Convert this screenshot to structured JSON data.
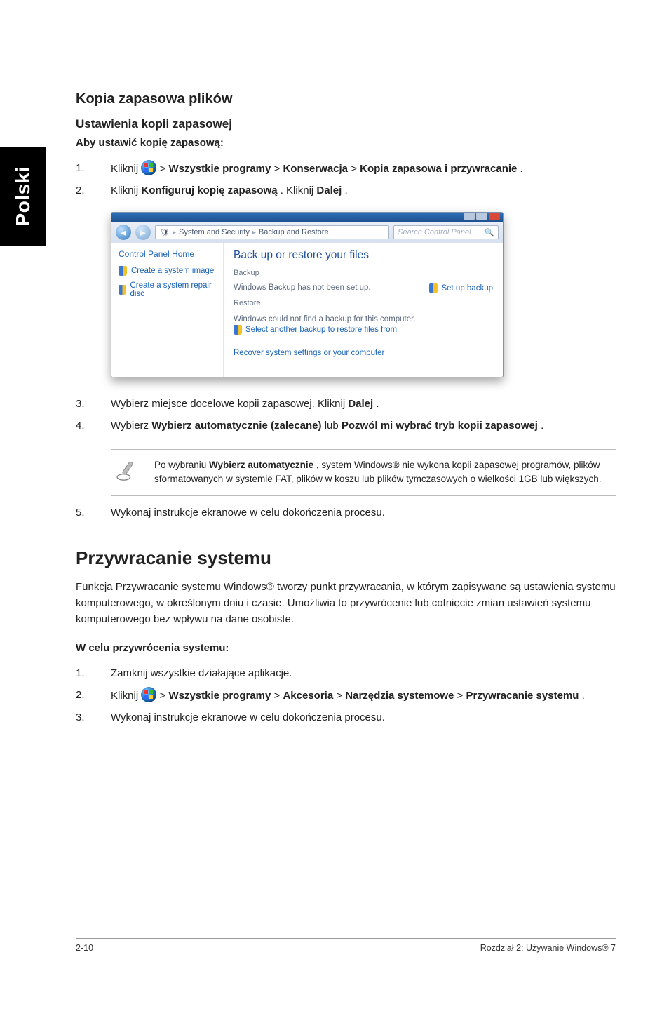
{
  "sidetab": "Polski",
  "h_backup_files": "Kopia zapasowa plików",
  "h_backup_settings": "Ustawienia kopii zapasowej",
  "lead_to_set_backup": "Aby ustawić kopię zapasową:",
  "steps_a": {
    "n1": "1.",
    "t1_pre": "Kliknij ",
    "t1_gt1": " > ",
    "t1_b1": "Wszystkie programy",
    "t1_gt2": " > ",
    "t1_b2": "Konserwacja",
    "t1_gt3": " > ",
    "t1_b3": "Kopia zapasowa i przywracanie",
    "t1_post": ".",
    "n2": "2.",
    "t2_pre": "Kliknij ",
    "t2_b1": "Konfiguruj kopię zapasową",
    "t2_mid": ". Kliknij ",
    "t2_b2": "Dalej",
    "t2_post": "."
  },
  "win": {
    "crumb1": "System and Security",
    "crumb2": "Backup and Restore",
    "search_placeholder": "Search Control Panel",
    "side_home": "Control Panel Home",
    "side_link1": "Create a system image",
    "side_link2": "Create a system repair disc",
    "main_title": "Back up or restore your files",
    "grp_backup": "Backup",
    "backup_msg": "Windows Backup has not been set up.",
    "setup_link": "Set up backup",
    "grp_restore": "Restore",
    "restore_msg1": "Windows could not find a backup for this computer.",
    "restore_msg2": "Select another backup to restore files from",
    "recover_link": "Recover system settings or your computer"
  },
  "steps_b": {
    "n3": "3.",
    "t3_pre": "Wybierz miejsce docelowe kopii zapasowej. Kliknij ",
    "t3_b": "Dalej",
    "t3_post": ".",
    "n4": "4.",
    "t4_pre": "Wybierz ",
    "t4_b1": "Wybierz automatycznie (zalecane)",
    "t4_mid": " lub ",
    "t4_b2": "Pozwól mi wybrać tryb kopii zapasowej",
    "t4_post": "."
  },
  "note": {
    "pre": "Po wybraniu ",
    "b": "Wybierz automatycznie",
    "post": ", system Windows® nie wykona kopii zapasowej programów, plików sformatowanych w systemie FAT, plików w koszu lub plików tymczasowych o wielkości 1GB lub większych."
  },
  "steps_c": {
    "n5": "5.",
    "t5": "Wykonaj instrukcje ekranowe w celu dokończenia procesu."
  },
  "h_restore": "Przywracanie systemu",
  "restore_para": "Funkcja Przywracanie systemu Windows® tworzy punkt przywracania, w którym zapisywane są ustawienia systemu komputerowego, w określonym dniu i czasie. Umożliwia to przywrócenie lub cofnięcie zmian ustawień systemu komputerowego bez wpływu na dane osobiste.",
  "lead_restore": "W celu przywrócenia systemu:",
  "steps_d": {
    "n1": "1.",
    "t1": "Zamknij wszystkie działające aplikacje.",
    "n2": "2.",
    "t2_pre": "Kliknij ",
    "t2_gt1": " > ",
    "t2_b1": "Wszystkie programy",
    "t2_gt2": " > ",
    "t2_b2": "Akcesoria",
    "t2_gt3": " > ",
    "t2_b3": "Narzędzia systemowe",
    "t2_gt4": " > ",
    "t2_b4": "Przywracanie systemu",
    "t2_post": ".",
    "n3": "3.",
    "t3": "Wykonaj instrukcje ekranowe w celu dokończenia procesu."
  },
  "footer": {
    "left": "2-10",
    "right": "Rozdział 2: Używanie Windows® 7"
  }
}
